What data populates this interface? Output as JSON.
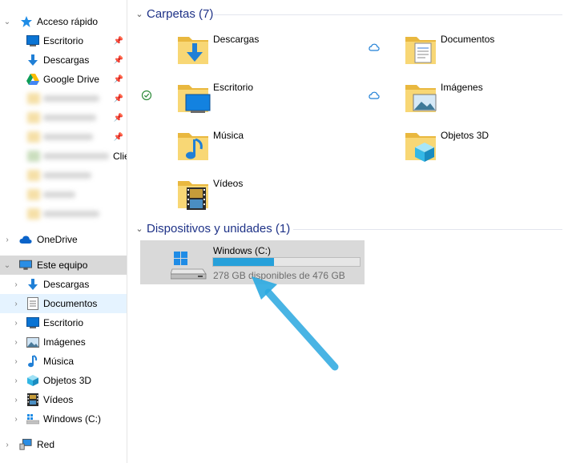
{
  "nav": {
    "quick_access": {
      "label": "Acceso rápido"
    },
    "pinned": [
      {
        "label": "Escritorio",
        "icon": "desktop-icon"
      },
      {
        "label": "Descargas",
        "icon": "downloads-icon"
      },
      {
        "label": "Google Drive",
        "icon": "google-drive-icon"
      }
    ],
    "blurred_count": 7,
    "truncated_label": "Clie",
    "onedrive": {
      "label": "OneDrive"
    },
    "this_pc": {
      "label": "Este equipo",
      "children": [
        {
          "label": "Descargas",
          "icon": "downloads-icon"
        },
        {
          "label": "Documentos",
          "icon": "documents-icon"
        },
        {
          "label": "Escritorio",
          "icon": "desktop-icon"
        },
        {
          "label": "Imágenes",
          "icon": "pictures-icon"
        },
        {
          "label": "Música",
          "icon": "music-icon"
        },
        {
          "label": "Objetos 3D",
          "icon": "3d-objects-icon"
        },
        {
          "label": "Vídeos",
          "icon": "videos-icon"
        },
        {
          "label": "Windows (C:)",
          "icon": "drive-icon"
        }
      ]
    },
    "network": {
      "label": "Red"
    }
  },
  "content": {
    "folders_header": "Carpetas (7)",
    "folders": [
      {
        "label": "Descargas",
        "overlay": "downloads",
        "status": ""
      },
      {
        "label": "Documentos",
        "overlay": "documents",
        "status": "cloud"
      },
      {
        "label": "Escritorio",
        "overlay": "desktop",
        "status": "synced"
      },
      {
        "label": "Imágenes",
        "overlay": "pictures",
        "status": "cloud"
      },
      {
        "label": "Música",
        "overlay": "music",
        "status": ""
      },
      {
        "label": "Objetos 3D",
        "overlay": "3d",
        "status": ""
      },
      {
        "label": "Vídeos",
        "overlay": "videos",
        "status": ""
      }
    ],
    "devices_header": "Dispositivos y unidades (1)",
    "drive": {
      "name": "Windows (C:)",
      "free_text": "278 GB disponibles de 476 GB",
      "used_fraction": 0.416
    }
  },
  "colors": {
    "accent": "#26a0da",
    "header_text": "#1e3287",
    "selected": "#d9d9d9",
    "hover": "#e5f3ff",
    "annotation_arrow": "#29a9e0"
  }
}
